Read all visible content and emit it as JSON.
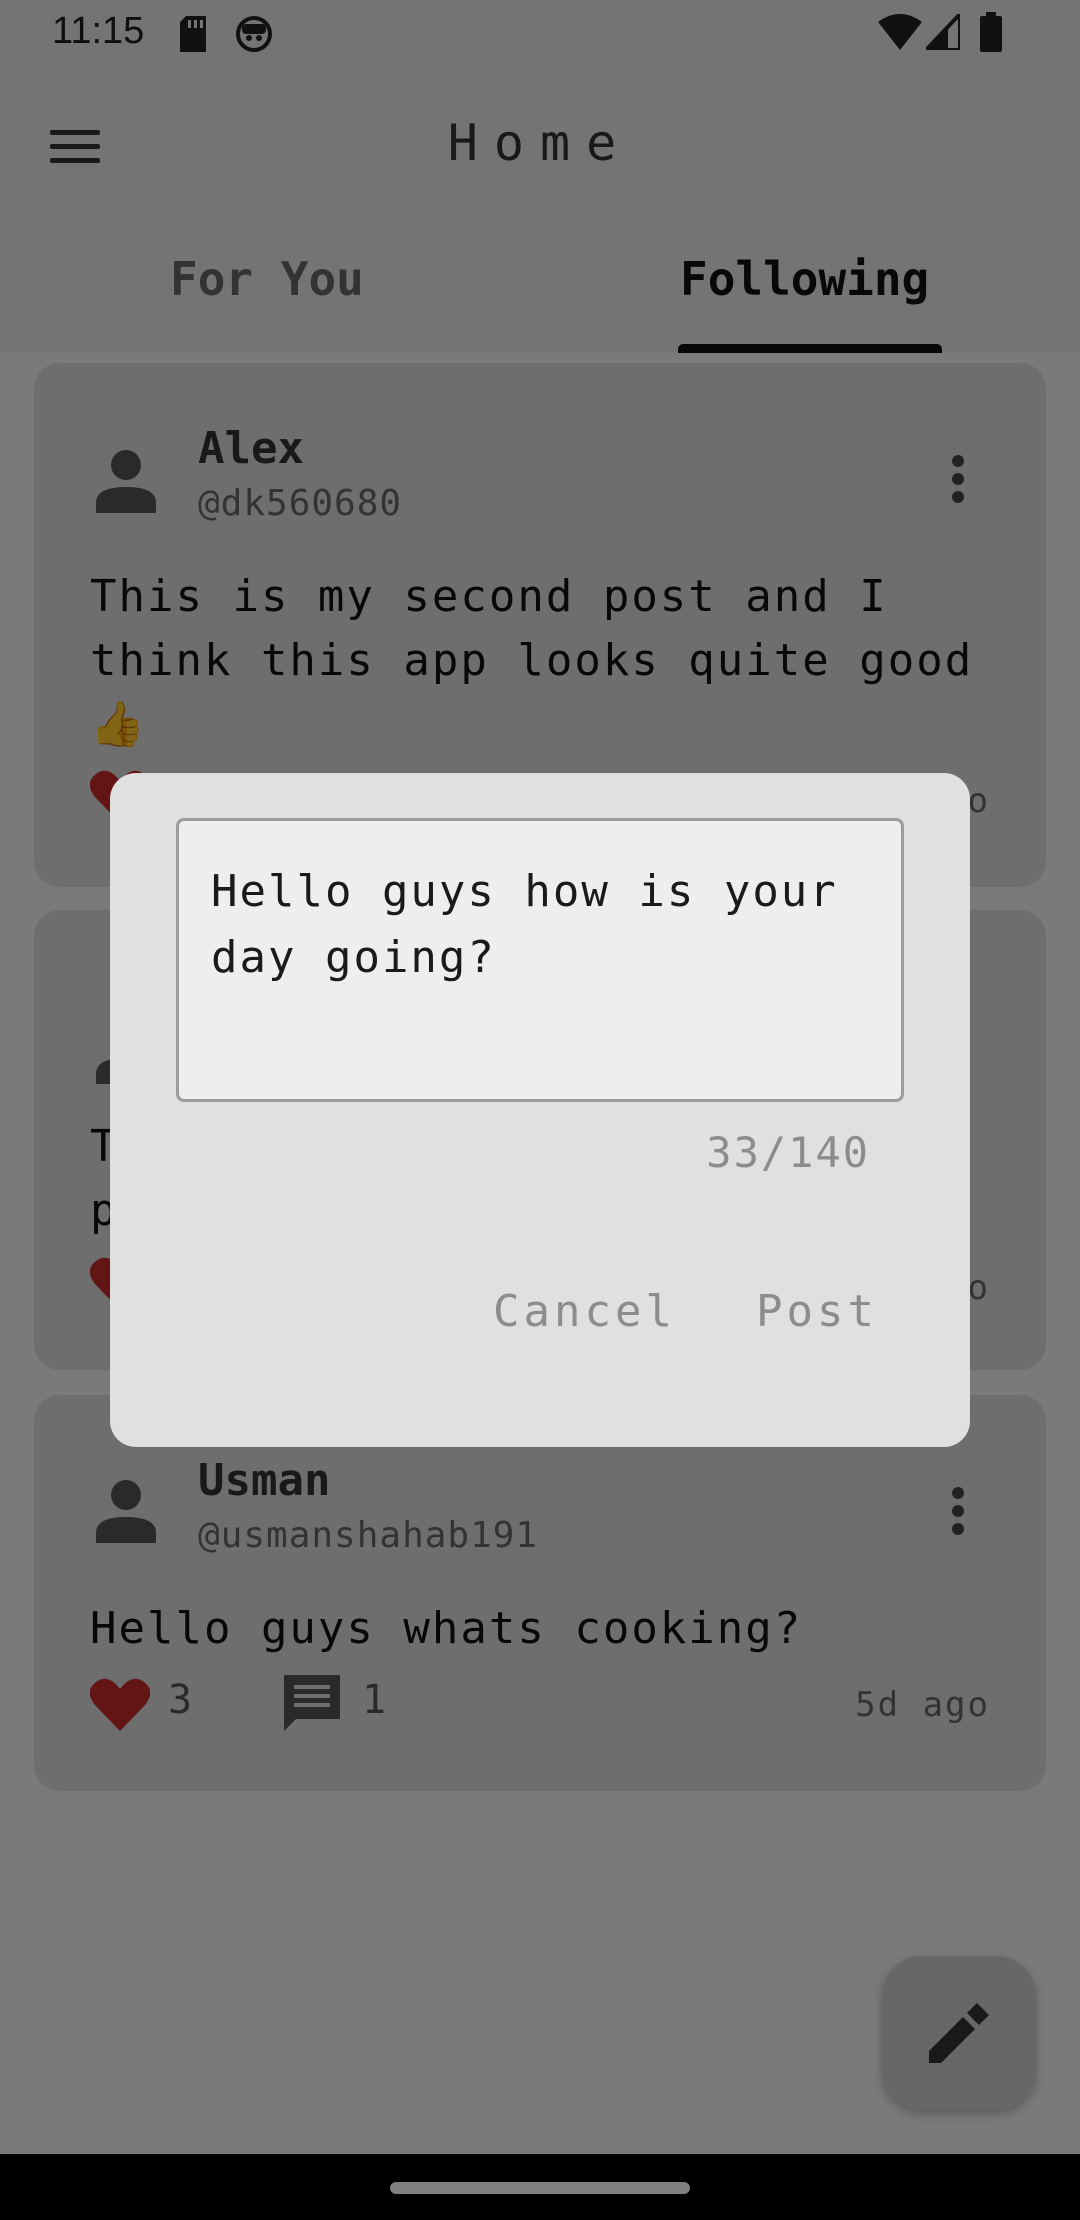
{
  "status_bar": {
    "time": "11:15",
    "icons": [
      "sd-card-icon",
      "face-icon",
      "wifi-icon",
      "signal-icon",
      "battery-icon"
    ]
  },
  "app_bar": {
    "title": "Home",
    "menu_icon": "menu-icon",
    "tabs": [
      {
        "label": "For You",
        "selected": false
      },
      {
        "label": "Following",
        "selected": true
      }
    ]
  },
  "posts": [
    {
      "name": "Alex",
      "handle": "@dk560680",
      "text": "This is my second post and I think this app looks quite good 👍",
      "likes": "",
      "comments": "",
      "time": "o"
    },
    {
      "name": "",
      "handle": "",
      "text": "T p",
      "likes": "",
      "comments": "",
      "time": "o"
    },
    {
      "name": "Usman",
      "handle": "@usmanshahab191",
      "text": "Hello guys whats cooking?",
      "likes": "3",
      "comments": "1",
      "time": "5d ago"
    }
  ],
  "dialog": {
    "input_value": "Hello guys how is your day going?",
    "char_count": "33/140",
    "cancel_label": "Cancel",
    "post_label": "Post"
  },
  "fab": {
    "icon": "edit-icon"
  },
  "colors": {
    "like": "#c62828",
    "scrim": "rgba(0,0,0,0.5)",
    "dialog_bg": "#e0e0e0"
  }
}
